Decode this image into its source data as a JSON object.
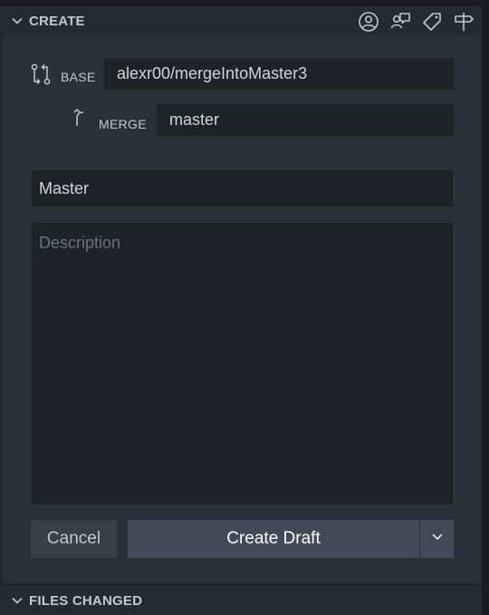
{
  "create_section": {
    "title": "CREATE",
    "actions": [
      "assignees-icon",
      "reviewers-icon",
      "labels-icon",
      "milestone-icon"
    ]
  },
  "base": {
    "label": "BASE",
    "value": "alexr00/mergeIntoMaster3"
  },
  "merge": {
    "label": "MERGE",
    "value": "master"
  },
  "title_field": {
    "value": "Master"
  },
  "description_field": {
    "value": "",
    "placeholder": "Description"
  },
  "buttons": {
    "cancel_label": "Cancel",
    "create_label": "Create Draft"
  },
  "files_section": {
    "title": "FILES CHANGED"
  },
  "colors": {
    "header_bg": "#262a31",
    "panel_bg": "#2c3038",
    "input_bg": "#1f2227",
    "primary_button": "#434957"
  }
}
